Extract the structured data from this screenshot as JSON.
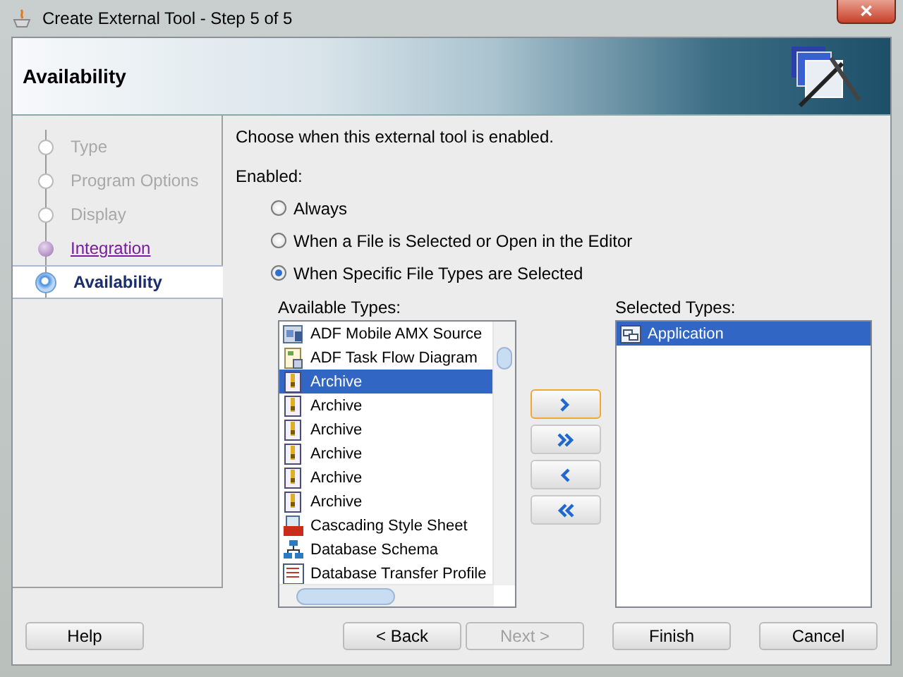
{
  "window": {
    "title": "Create External Tool - Step 5 of 5",
    "close": "✕"
  },
  "header": {
    "title": "Availability"
  },
  "steps": [
    {
      "label": "Type",
      "kind": "visited",
      "selected": false
    },
    {
      "label": "Program Options",
      "kind": "visited",
      "selected": false
    },
    {
      "label": "Display",
      "kind": "visited",
      "selected": false
    },
    {
      "label": "Integration",
      "kind": "link",
      "selected": false
    },
    {
      "label": "Availability",
      "kind": "current",
      "selected": true
    }
  ],
  "intro": "Choose when this external tool is enabled.",
  "enabled_label": "Enabled:",
  "options": [
    {
      "label": "Always",
      "selected": false
    },
    {
      "label": "When a File is Selected or Open in the Editor",
      "selected": false
    },
    {
      "label": "When Specific File Types are Selected",
      "selected": true
    }
  ],
  "available": {
    "label": "Available Types:",
    "items": [
      {
        "label": "ADF Mobile AMX Source",
        "kind": "amx",
        "selected": false
      },
      {
        "label": "ADF Task Flow Diagram",
        "kind": "taskflow",
        "selected": false
      },
      {
        "label": "Archive",
        "kind": "archive",
        "selected": true
      },
      {
        "label": "Archive",
        "kind": "archive",
        "selected": false
      },
      {
        "label": "Archive",
        "kind": "archive",
        "selected": false
      },
      {
        "label": "Archive",
        "kind": "archive",
        "selected": false
      },
      {
        "label": "Archive",
        "kind": "archive",
        "selected": false
      },
      {
        "label": "Archive",
        "kind": "archive",
        "selected": false
      },
      {
        "label": "Cascading Style Sheet",
        "kind": "css",
        "selected": false
      },
      {
        "label": "Database Schema",
        "kind": "schema",
        "selected": false
      },
      {
        "label": "Database Transfer Profile",
        "kind": "transfer",
        "selected": false
      }
    ]
  },
  "move_buttons": [
    {
      "kind": "add",
      "focused": true
    },
    {
      "kind": "add_all",
      "focused": false
    },
    {
      "kind": "remove",
      "focused": false
    },
    {
      "kind": "remove_all",
      "focused": false
    }
  ],
  "selected": {
    "label": "Selected Types:",
    "items": [
      {
        "label": "Application",
        "kind": "application",
        "selected": true
      }
    ]
  },
  "buttons": [
    {
      "label": "Help",
      "disabled": false
    },
    {
      "label": "< Back",
      "disabled": false
    },
    {
      "label": "Next >",
      "disabled": true
    },
    {
      "label": "Finish",
      "disabled": false
    },
    {
      "label": "Cancel",
      "disabled": false
    }
  ]
}
